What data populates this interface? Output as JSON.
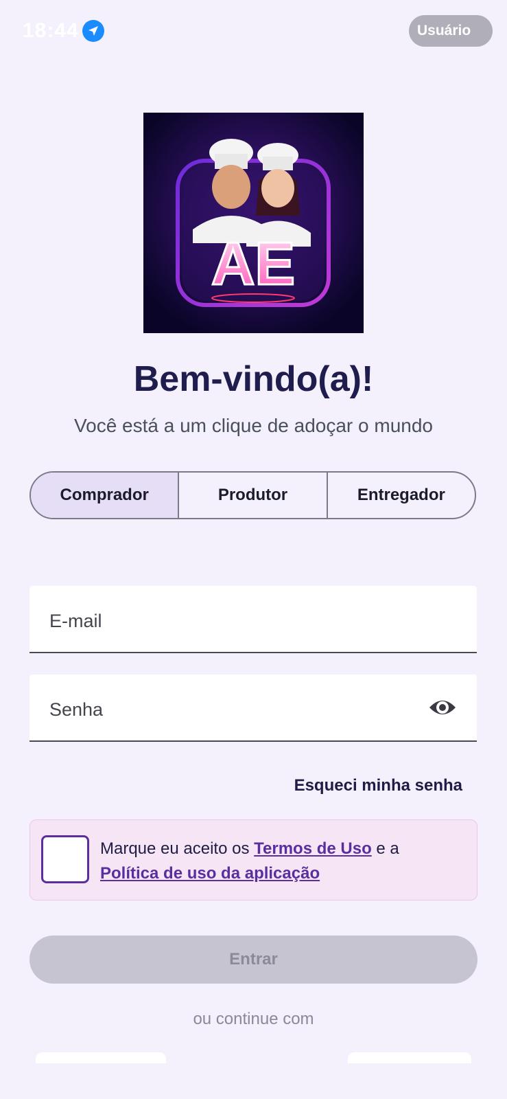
{
  "status_bar": {
    "time": "18:44",
    "pill_text": "Usuário"
  },
  "logo": {
    "letters": "AE"
  },
  "header": {
    "title": "Bem-vindo(a)!",
    "subtitle": "Você está a um clique de adoçar o mundo"
  },
  "role_tabs": {
    "items": [
      "Comprador",
      "Produtor",
      "Entregador"
    ],
    "selected": "Comprador"
  },
  "form": {
    "email_label": "E-mail",
    "password_label": "Senha",
    "forgot_password": "Esqueci minha senha"
  },
  "terms": {
    "prefix": "Marque eu aceito os ",
    "terms_link": "Termos de Uso",
    "middle": " e a ",
    "policy_link": "Política de uso da aplicação",
    "checked": false
  },
  "actions": {
    "enter_label": "Entrar",
    "or_continue": "ou continue com"
  },
  "colors": {
    "background": "#f4f1fc",
    "accent": "#5b2ea0",
    "selected_tab": "#e6ddf7",
    "disabled_button": "#c6c4d1"
  }
}
